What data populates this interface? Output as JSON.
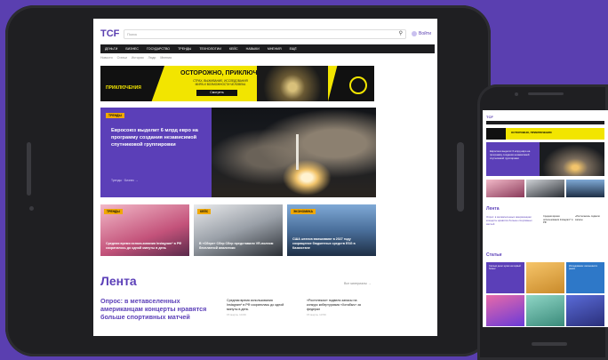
{
  "tablet_site": {
    "logo": "TCF",
    "search_placeholder": "Поиск",
    "search_icon": "search-icon",
    "login_label": "Войти",
    "nav": [
      "Деньги",
      "Бизнес",
      "Государство",
      "Тренды",
      "Технологии",
      "Кейс",
      "Навыки",
      "Мнения",
      "Ещё"
    ],
    "breadcrumbs": [
      "Новости",
      "Статьи",
      "Истории",
      "Люди",
      "Мнения"
    ],
    "banner": {
      "left_text": "ПРИКЛЮЧЕНИЯ",
      "title": "ОСТОРОЖНО, ПРИКЛЮЧЕНИЯ",
      "age": "16+",
      "subtitle": "СТРАХ, ВЫЖИВАНИЕ, ИССЛЕДОВАНИЯ МИРА И ВОЗМОЖНОСТИ ЧЕЛОВЕКА",
      "button": "Смотреть"
    },
    "hero": {
      "tag": "Тренды",
      "title": "Евросоюз выделит 6 млрд евро на программу создания независимой спутниковой группировки",
      "meta": "Тренды · Бизнес →"
    },
    "cards": [
      {
        "tag": "Тренды",
        "text": "Средняя время использования Instagram* в РФ сократилось до одной минуты в день"
      },
      {
        "tag": "Кейс",
        "text": "В «Сбере» Сбер Сбер представили VR-полном бесплатной аналитики"
      },
      {
        "tag": "Экономика",
        "text": "США штатов вмешивают в 2027 году сокращение бюджетных средств ESG в Казахстане"
      }
    ],
    "lenta": {
      "heading": "Лента",
      "all_link": "Все материалы →",
      "big_item": "Опрос: в метавселенных американцам концерты нравятся больше спортивных матчей",
      "items": [
        {
          "text": "Средняя время использования Instagram* в РФ сократилась до одной минуты в день",
          "date": "15 марта, 14:00"
        },
        {
          "text": "«Ростелеком» подвели запасы на конкурс кибертуризма «Хотабыч» за федерал",
          "date": "15 марта, 13:50"
        }
      ]
    }
  },
  "phone_site": {
    "logo": "TCF",
    "banner_title": "ОСТОРОЖНО, ПРИКЛЮЧЕНИЯ",
    "hero_title": "Евросоюз выделит 6 млрд евро на программу создания независимой спутниковой группировки",
    "lenta_heading": "Лента",
    "lenta_big": "Опрос: в метавселенных американцам концерты нравятся больше спортивных матчей",
    "lenta_items": [
      "Средняя время использования Instagram* в РФ",
      "«Ростелеком» подвели запасы"
    ],
    "stati_heading": "Статьи",
    "grid_texts": [
      "Сколько денег нужно на первый бизнес",
      "",
      "Исследование: как меняется рынок",
      "",
      "",
      ""
    ]
  },
  "colors": {
    "background": "#5a3fb0",
    "accent": "#5b3fb8",
    "banner_yellow": "#f2e500",
    "tag_orange": "#f0a800"
  }
}
